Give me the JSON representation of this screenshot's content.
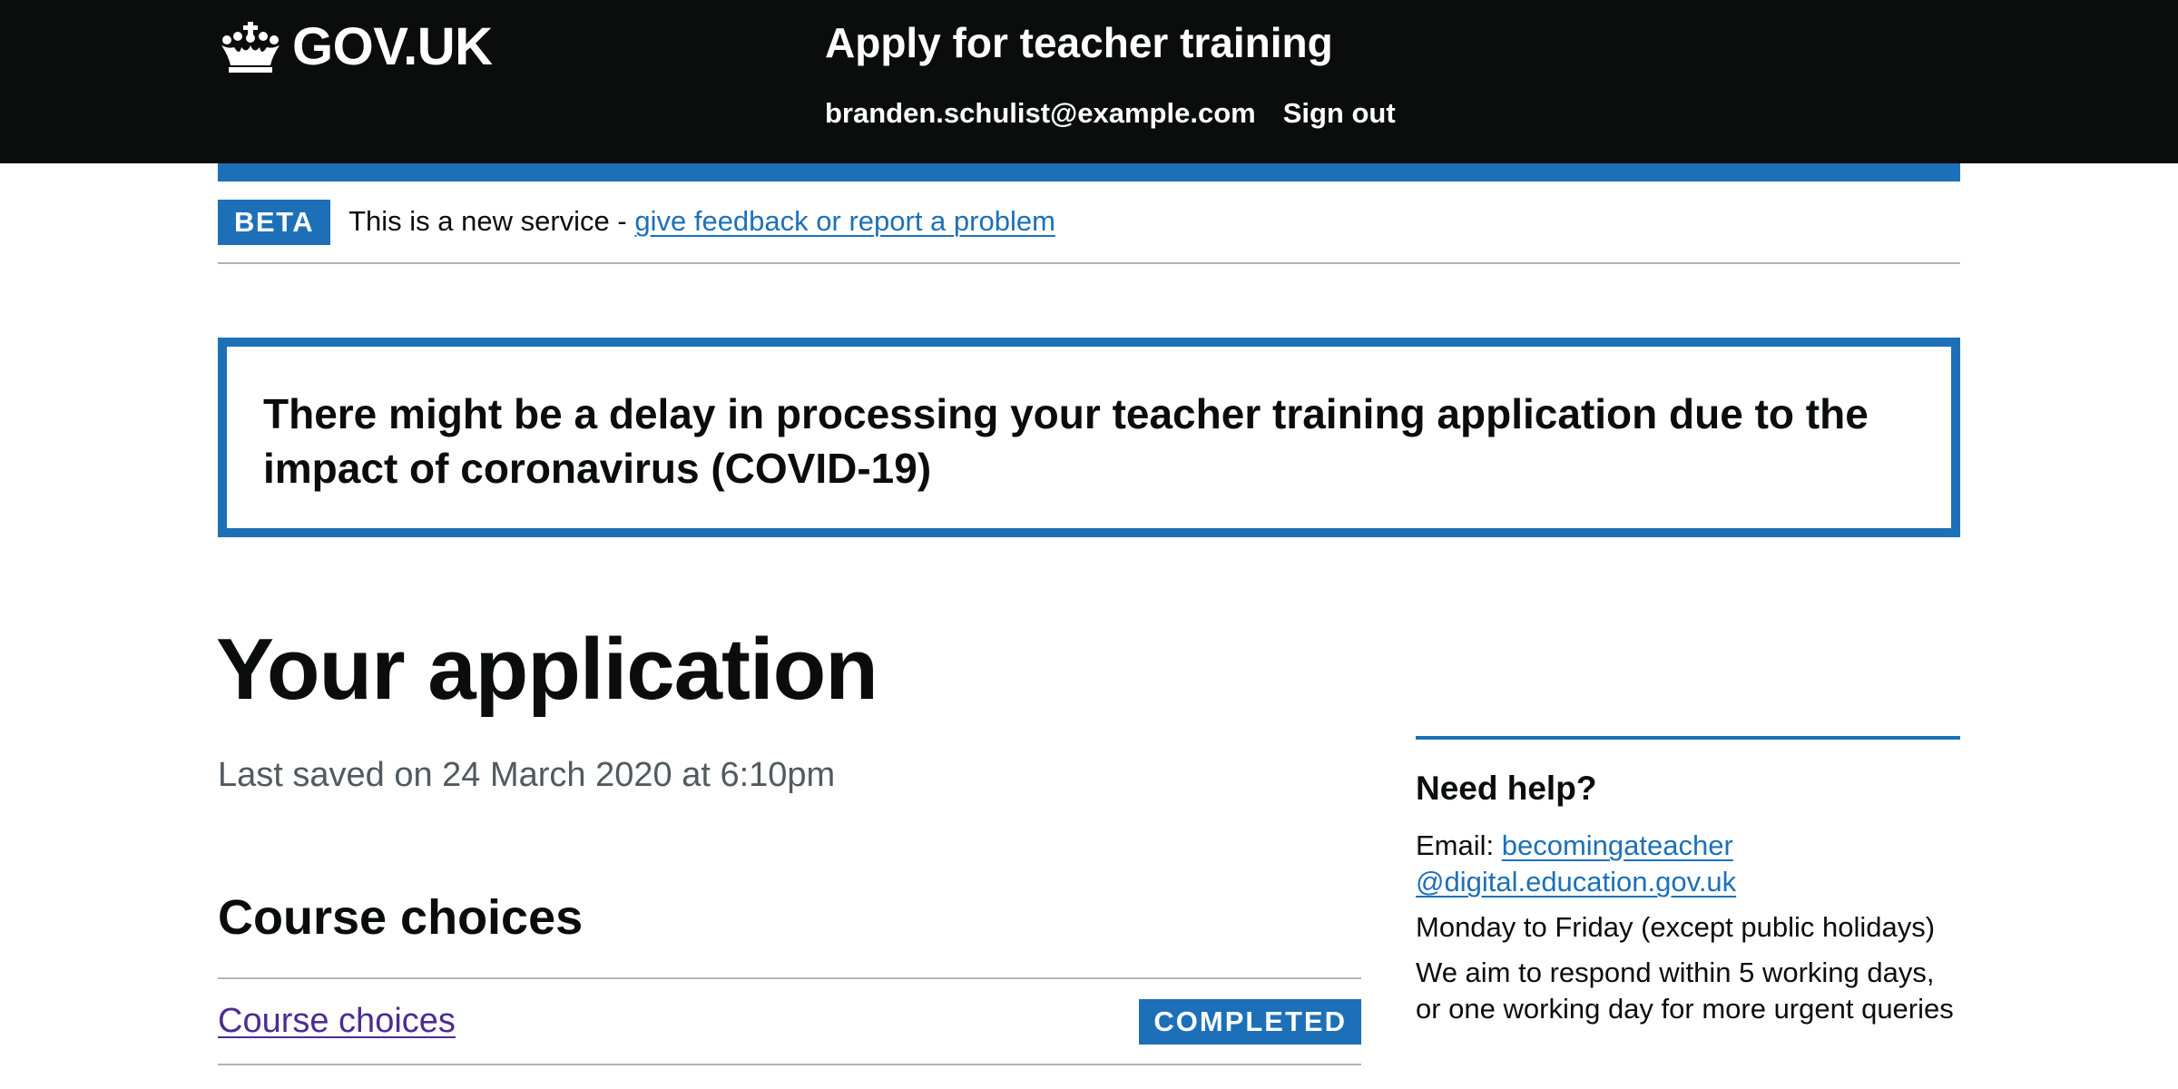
{
  "header": {
    "logo_text": "GOV.UK",
    "service_name": "Apply for teacher training",
    "nav": {
      "email": "branden.schulist@example.com",
      "sign_out": "Sign out"
    }
  },
  "phase_banner": {
    "tag": "BETA",
    "text": "This is a new service - ",
    "link": "give feedback or report a problem"
  },
  "notification": {
    "heading": "There might be a delay in processing your teacher training application due to the impact of coronavirus (COVID-19)"
  },
  "main": {
    "title": "Your application",
    "last_saved": "Last saved on 24 March 2020 at 6:10pm",
    "sections": [
      {
        "heading": "Course choices",
        "tasks": [
          {
            "label": "Course choices",
            "status": "COMPLETED"
          }
        ]
      }
    ]
  },
  "sidebar": {
    "heading": "Need help?",
    "email_label": "Email: ",
    "email_line1": "becomingateacher",
    "email_line2": "@digital.education.gov.uk",
    "hours": "Monday to Friday (except public holidays)",
    "response": "We aim to respond within 5 working days, or one working day for more urgent queries"
  },
  "colors": {
    "header_bg": "#0b0c0c",
    "brand_blue": "#1d70b8",
    "visited_link": "#4c2c92",
    "secondary_text": "#505a5f",
    "border": "#b1b4b6"
  }
}
